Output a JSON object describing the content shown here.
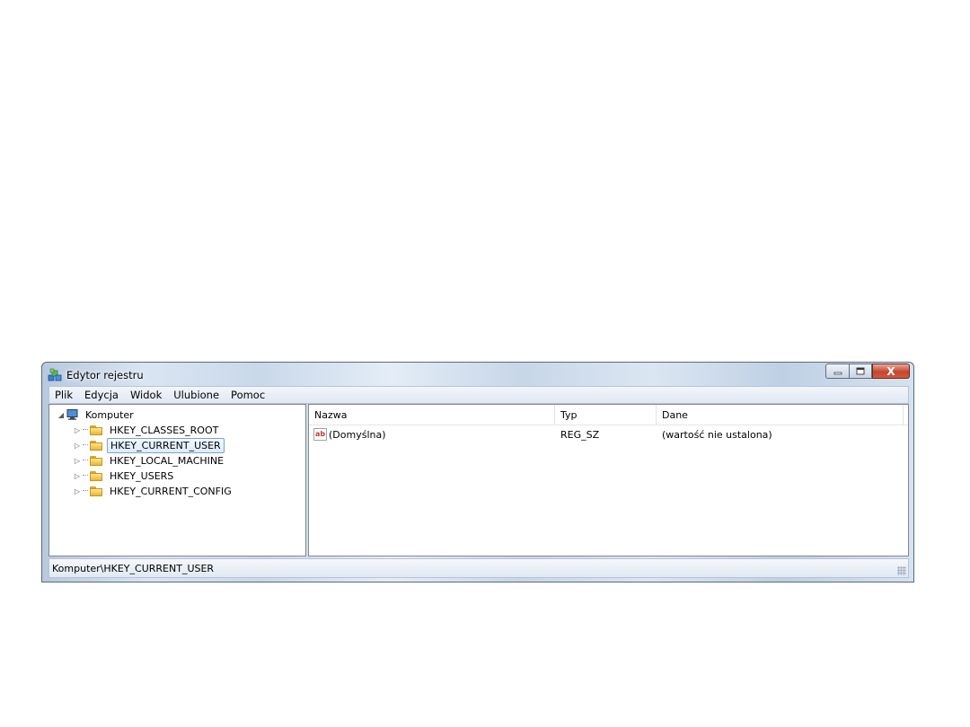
{
  "window": {
    "title": "Edytor rejestru",
    "icon": "regedit-icon",
    "close_glyph": "X"
  },
  "menu": [
    "Plik",
    "Edycja",
    "Widok",
    "Ulubione",
    "Pomoc"
  ],
  "tree": {
    "root": "Komputer",
    "items": [
      {
        "label": "HKEY_CLASSES_ROOT",
        "selected": false
      },
      {
        "label": "HKEY_CURRENT_USER",
        "selected": true
      },
      {
        "label": "HKEY_LOCAL_MACHINE",
        "selected": false
      },
      {
        "label": "HKEY_USERS",
        "selected": false
      },
      {
        "label": "HKEY_CURRENT_CONFIG",
        "selected": false
      }
    ]
  },
  "list": {
    "columns": [
      "Nazwa",
      "Typ",
      "Dane"
    ],
    "rows": [
      {
        "icon": "string-value-icon",
        "icon_text": "ab",
        "name": "(Domyślna)",
        "type": "REG_SZ",
        "data": "(wartość nie ustalona)"
      }
    ]
  },
  "status": {
    "path": "Komputer\\HKEY_CURRENT_USER"
  },
  "colors": {
    "selection_border": "#7da2ce",
    "close_button": "#c5462e"
  }
}
